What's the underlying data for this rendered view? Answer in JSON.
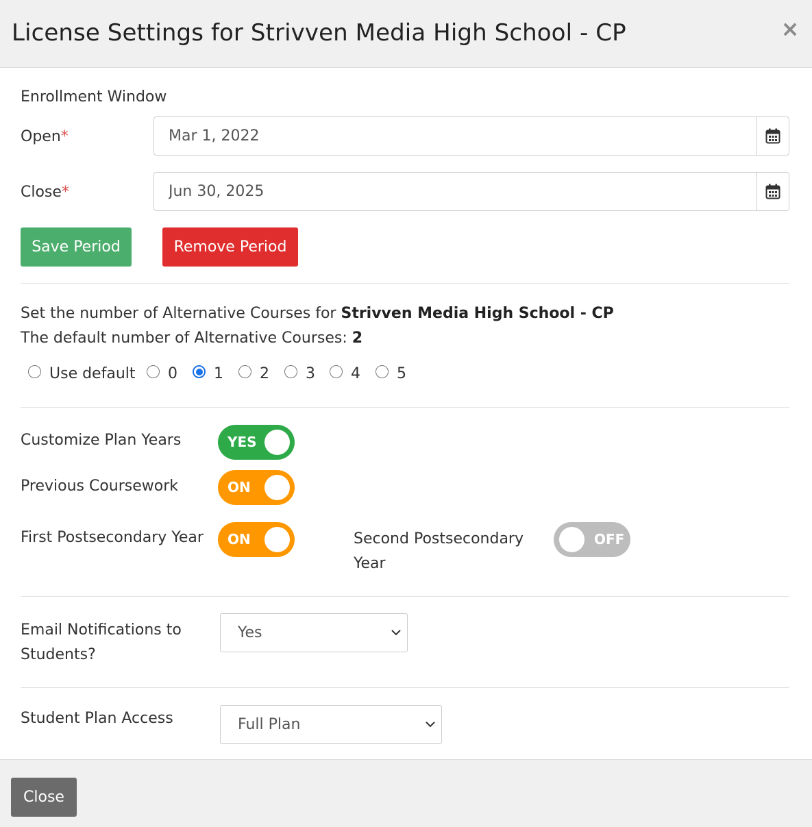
{
  "modal": {
    "title": "License Settings for Strivven Media High School - CP",
    "close_glyph": "×"
  },
  "enrollment": {
    "heading": "Enrollment Window",
    "open_label": "Open",
    "close_label": "Close",
    "required_mark": "*",
    "open_value": "Mar 1, 2022",
    "close_value": "Jun 30, 2025",
    "calendar_icon": "calendar-icon",
    "save_label": "Save Period",
    "remove_label": "Remove Period"
  },
  "alternatives": {
    "prompt": "Set the number of Alternative Courses for ",
    "school": "Strivven Media High School - CP",
    "default_text": "The default number of Alternative Courses: ",
    "default_value": "2",
    "options": [
      "Use default",
      "0",
      "1",
      "2",
      "3",
      "4",
      "5"
    ],
    "selected": "1"
  },
  "toggles": {
    "customize_label": "Customize Plan Years",
    "customize_state": "YES",
    "previous_label": "Previous Coursework",
    "previous_state": "ON",
    "first_label": "First Postsecondary Year",
    "first_state": "ON",
    "second_label_line1": "Second Postsecondary",
    "second_label_line2": "Year",
    "second_state": "OFF"
  },
  "email": {
    "label_line1": "Email Notifications to",
    "label_line2": "Students?",
    "value": "Yes"
  },
  "access": {
    "label": "Student Plan Access",
    "value": "Full Plan"
  },
  "footer": {
    "close_label": "Close"
  },
  "colors": {
    "save_green": "#4cae6c",
    "remove_red": "#e02d2d",
    "toggle_green": "#2eaa48",
    "toggle_orange": "#ff9800",
    "toggle_gray": "#bdbdbd",
    "radio_blue": "#1a73e8",
    "close_gray": "#6b6b6b"
  }
}
